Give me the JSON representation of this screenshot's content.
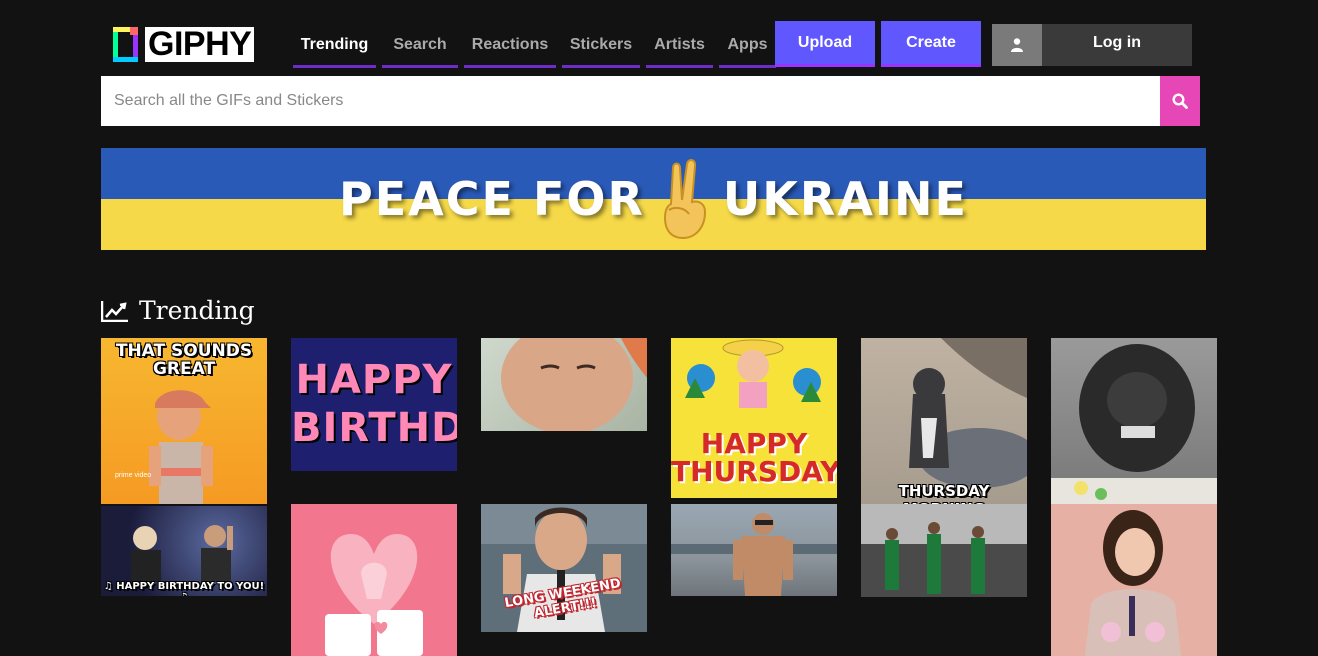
{
  "brand": {
    "logo_text": "GIPHY"
  },
  "nav": [
    {
      "label": "Trending",
      "active": true
    },
    {
      "label": "Search"
    },
    {
      "label": "Reactions"
    },
    {
      "label": "Stickers"
    },
    {
      "label": "Artists"
    },
    {
      "label": "Apps"
    }
  ],
  "actions": {
    "upload_label": "Upload",
    "create_label": "Create",
    "login_label": "Log in"
  },
  "search": {
    "placeholder": "Search all the GIFs and Stickers"
  },
  "banner": {
    "text_left": "PEACE FOR",
    "text_right": "UKRAINE"
  },
  "trending": {
    "title": "Trending"
  },
  "gifs": {
    "sounds_great": "THAT SOUNDS GREAT",
    "prime_video": "prime video",
    "happy_birthday": "HAPPY BIRTHDAY",
    "happy_thursday": "HAPPY THURSDAY",
    "thursday_morning": "THURSDAY MORNING",
    "birthday_to_you": "♫ HAPPY BIRTHDAY TO YOU! ♫",
    "long_weekend": "LONG WEEKEND ALERT!!!"
  },
  "colors": {
    "background": "#121212",
    "upload": "#6157ff",
    "search_button": "#e646b6",
    "nav_underline": "#6f2dc8"
  },
  "icons": {
    "login": "user-icon",
    "search": "search-icon",
    "trending": "trending-chart-icon"
  }
}
